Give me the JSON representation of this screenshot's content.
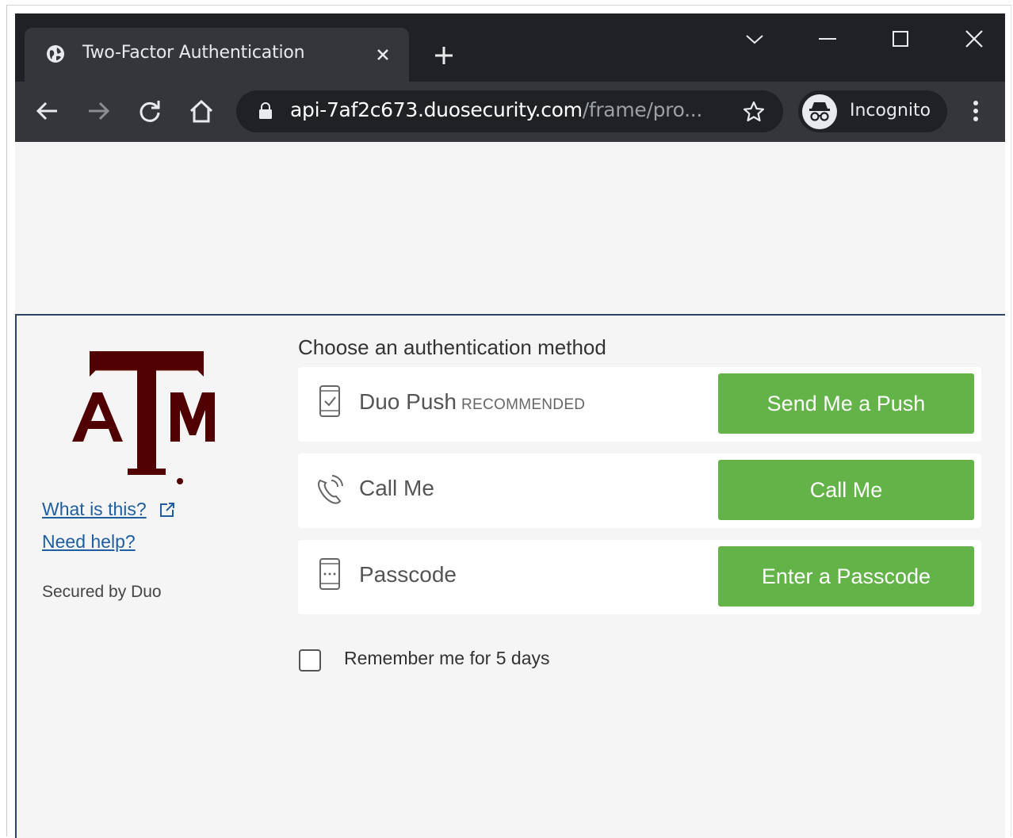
{
  "browser": {
    "tab_title": "Two-Factor Authentication",
    "url_host": "api-7af2c673.duosecurity.com",
    "url_path": "/frame/pro...",
    "incognito_label": "Incognito"
  },
  "sidebar": {
    "what_is_this": "What is this?",
    "need_help": "Need help?",
    "secured_by": "Secured by Duo"
  },
  "main": {
    "heading": "Choose an authentication method",
    "methods": [
      {
        "label": "Duo Push",
        "badge": "RECOMMENDED",
        "button": "Send Me a Push",
        "icon": "phone-check-icon"
      },
      {
        "label": "Call Me",
        "badge": "",
        "button": "Call Me",
        "icon": "phone-call-icon"
      },
      {
        "label": "Passcode",
        "badge": "",
        "button": "Enter a Passcode",
        "icon": "passcode-device-icon"
      }
    ],
    "remember_label": "Remember me for 5 days",
    "remember_checked": false
  },
  "colors": {
    "button_green": "#63b348",
    "brand_maroon": "#500000",
    "link_blue": "#1f5f9f"
  }
}
